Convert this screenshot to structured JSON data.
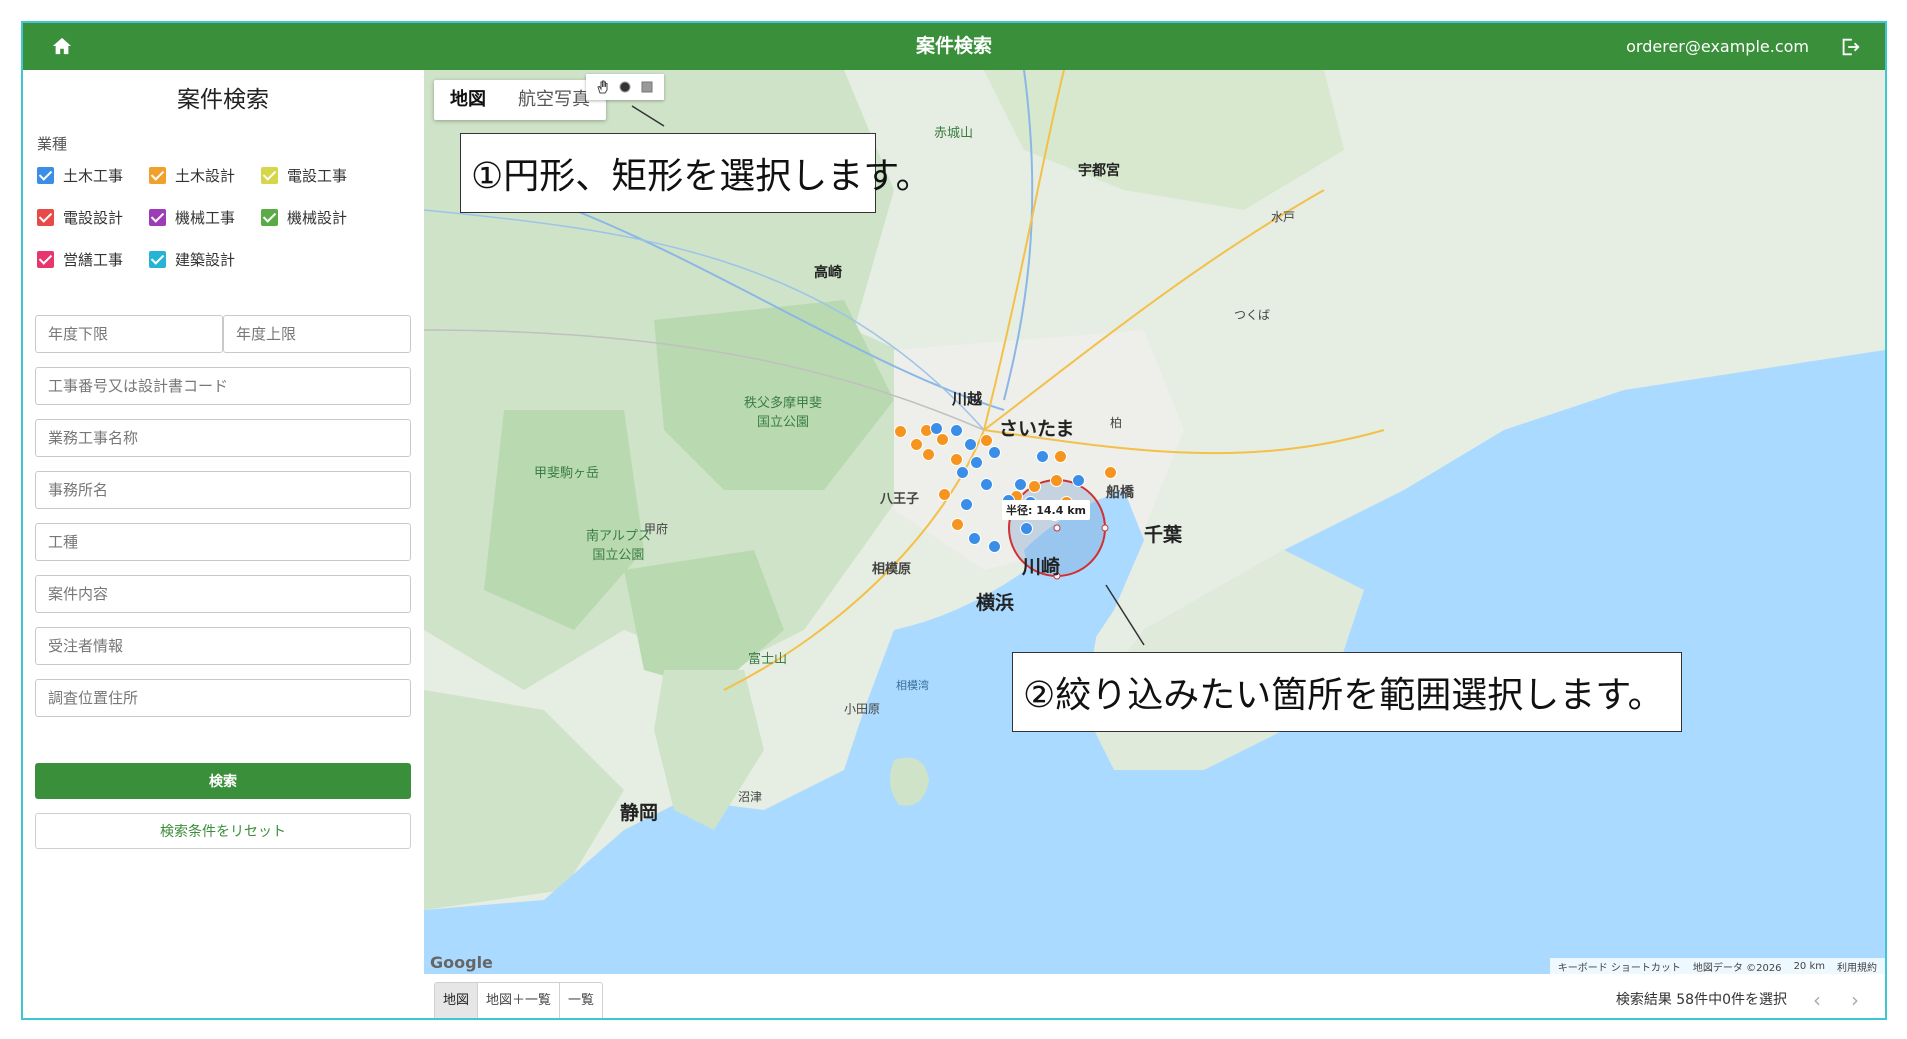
{
  "header": {
    "title": "案件検索",
    "user_email": "orderer@example.com"
  },
  "sidebar": {
    "title": "案件検索",
    "category_label": "業種",
    "categories": [
      {
        "label": "土木工事",
        "color": "#3b8ee8",
        "checked": true
      },
      {
        "label": "土木設計",
        "color": "#f1a02b",
        "checked": true
      },
      {
        "label": "電設工事",
        "color": "#d6d64a",
        "checked": true
      },
      {
        "label": "電設設計",
        "color": "#e84a4a",
        "checked": true
      },
      {
        "label": "機械工事",
        "color": "#9c3cb7",
        "checked": true
      },
      {
        "label": "機械設計",
        "color": "#5aab46",
        "checked": true
      },
      {
        "label": "営繕工事",
        "color": "#e8356e",
        "checked": true
      },
      {
        "label": "建築設計",
        "color": "#27b3d6",
        "checked": true
      }
    ],
    "fields": {
      "year_min": "年度下限",
      "year_max": "年度上限",
      "code": "工事番号又は設計書コード",
      "name": "業務工事名称",
      "office": "事務所名",
      "work_type": "工種",
      "content": "案件内容",
      "contractor": "受注者情報",
      "address": "調査位置住所"
    },
    "search_button": "検索",
    "reset_button": "検索条件をリセット"
  },
  "map": {
    "type_tabs": [
      "地図",
      "航空写真"
    ],
    "active_type": "地図",
    "callout1": "①円形、矩形を選択します。",
    "callout2": "②絞り込みたい箇所を範囲選択します。",
    "radius_label": "半径: 14.4 km",
    "labels": {
      "saitama": "さいたま",
      "kawagoe": "川越",
      "chiba": "千葉",
      "kawasaki": "川崎",
      "yokohama": "横浜",
      "shizuoka": "静岡",
      "utsunomiya": "宇都宮",
      "takasaki": "高崎",
      "funabashi": "船橋",
      "sagamihara": "相模原",
      "hachioji": "八王子",
      "kofu": "甲府",
      "odawara": "小田原",
      "mito": "水戸",
      "tsukuba": "つくば",
      "kashiwa": "柏",
      "numazu": "沼津",
      "fuji_park": "富士山",
      "chichibu_park": "秩父多摩甲斐\n国立公園",
      "alps_park": "南アルプス\n国立公園",
      "kaikoma": "甲斐駒ヶ岳",
      "akagi": "赤城山",
      "sagami_bay": "相模湾"
    },
    "attribution": [
      "キーボード ショートカット",
      "地図データ ©2026",
      "20 km",
      "利用規約"
    ],
    "google": "Google"
  },
  "bottom": {
    "view_tabs": [
      "地図",
      "地図＋一覧",
      "一覧"
    ],
    "active_view": "地図",
    "result_text": "検索結果 58件中0件を選択"
  }
}
